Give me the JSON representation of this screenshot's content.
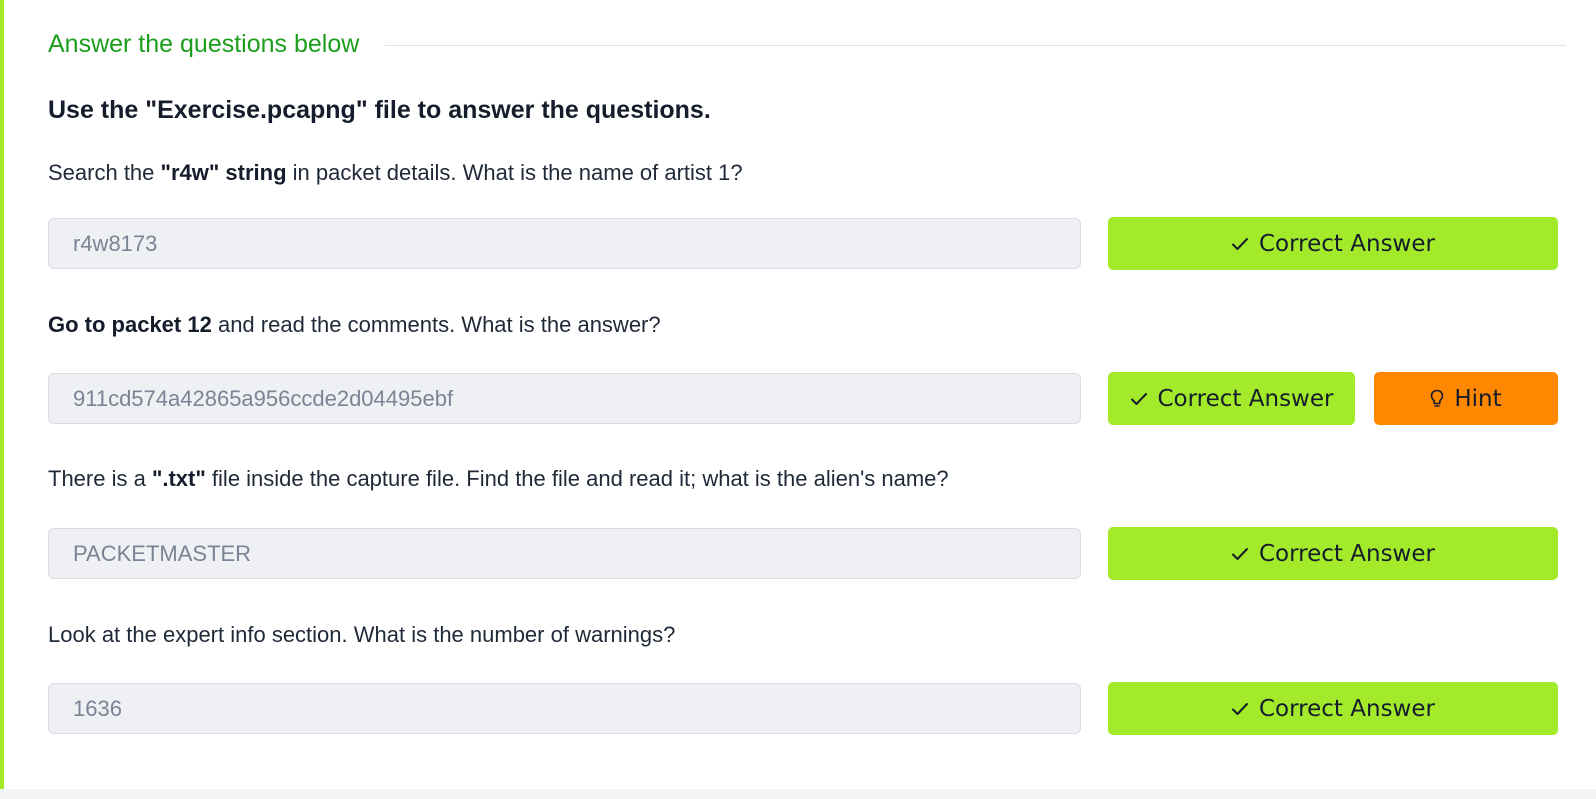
{
  "section": {
    "title": "Answer the questions below"
  },
  "intro": "Use the \"Exercise.pcapng\" file to answer the questions.",
  "questions": [
    {
      "parts": [
        {
          "text": "Search the ",
          "bold": false
        },
        {
          "text": "\"r4w\" string",
          "bold": true
        },
        {
          "text": " in packet details. What is the name of artist 1?",
          "bold": false
        }
      ],
      "answer": "r4w8173",
      "button": "Correct Answer"
    },
    {
      "parts": [
        {
          "text": "Go to packet 12",
          "bold": true
        },
        {
          "text": " and read the comments. What is the answer?",
          "bold": false
        }
      ],
      "answer": "911cd574a42865a956ccde2d04495ebf",
      "button": "Correct Answer",
      "hint": "Hint"
    },
    {
      "parts": [
        {
          "text": "There is a ",
          "bold": false
        },
        {
          "text": "\".txt\"",
          "bold": true
        },
        {
          "text": " file inside the capture file. Find the file and read it; what is the alien's name?",
          "bold": false
        }
      ],
      "answer": "PACKETMASTER",
      "button": "Correct Answer"
    },
    {
      "parts": [
        {
          "text": "Look at the expert info section. What is the number of warnings?",
          "bold": false
        }
      ],
      "answer": "1636",
      "button": "Correct Answer"
    }
  ],
  "icons": {
    "correct": "check-icon",
    "hint": "lightbulb-icon"
  },
  "colors": {
    "accent": "#a3ea2a",
    "section_title": "#1c9e1c",
    "hint": "#ff8800"
  }
}
